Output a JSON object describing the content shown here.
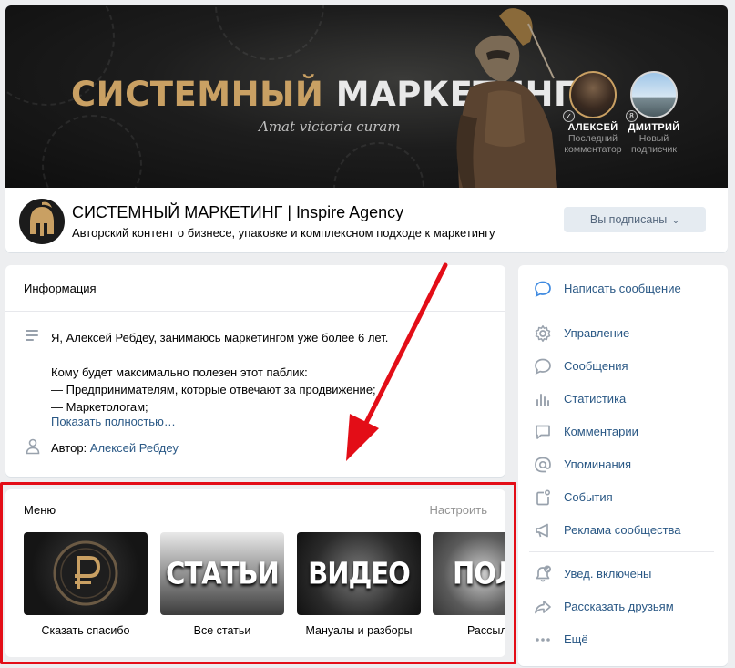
{
  "cover": {
    "title_word1": "СИСТЕМНЫЙ",
    "title_word2": "МАРКЕТИНГ",
    "subtitle": "Amat victoria curam",
    "people": [
      {
        "name": "АЛЕКСЕЙ",
        "role_line1": "Последний",
        "role_line2": "комментатор"
      },
      {
        "name": "ДМИТРИЙ",
        "role_line1": "Новый",
        "role_line2": "подписчик"
      }
    ]
  },
  "group": {
    "name": "СИСТЕМНЫЙ МАРКЕТИНГ | Inspire Agency",
    "description": "Авторский контент о бизнесе, упаковке и комплексном подходе к маркетингу",
    "subscribe_label": "Вы подписаны"
  },
  "info": {
    "title": "Информация",
    "lines": [
      "Я, Алексей Ребдеу, занимаюсь маркетингом уже более 6 лет.",
      "",
      "Кому будет максимально полезен этот паблик:",
      "— Предпринимателям, которые отвечают за продвижение;",
      "— Маркетологам;"
    ],
    "show_more": "Показать полностью…",
    "author_label": "Автор:",
    "author_name": "Алексей Ребдеу"
  },
  "menu": {
    "title": "Меню",
    "configure": "Настроить",
    "items": [
      {
        "thumb_text": "",
        "label": "Сказать спасибо"
      },
      {
        "thumb_text": "СТАТЬИ",
        "label": "Все статьи"
      },
      {
        "thumb_text": "ВИДЕО",
        "label": "Мануалы и разборы"
      },
      {
        "thumb_text": "ПОЛЬ",
        "label": "Рассыл"
      }
    ]
  },
  "sidebar": {
    "items": [
      {
        "label": "Написать сообщение",
        "icon": "message-bubble-icon"
      },
      {
        "label": "Управление",
        "icon": "gear-icon"
      },
      {
        "label": "Сообщения",
        "icon": "chat-icon"
      },
      {
        "label": "Статистика",
        "icon": "bar-chart-icon"
      },
      {
        "label": "Комментарии",
        "icon": "comment-icon"
      },
      {
        "label": "Упоминания",
        "icon": "at-sign-icon"
      },
      {
        "label": "События",
        "icon": "calendar-icon"
      },
      {
        "label": "Реклама сообщества",
        "icon": "megaphone-icon"
      },
      {
        "label": "Увед. включены",
        "icon": "bell-check-icon"
      },
      {
        "label": "Рассказать друзьям",
        "icon": "share-arrow-icon"
      },
      {
        "label": "Ещё",
        "icon": "more-dots-icon"
      }
    ]
  },
  "colors": {
    "link": "#2a5885",
    "highlight": "#e30d17",
    "gold": "#c9a063"
  }
}
